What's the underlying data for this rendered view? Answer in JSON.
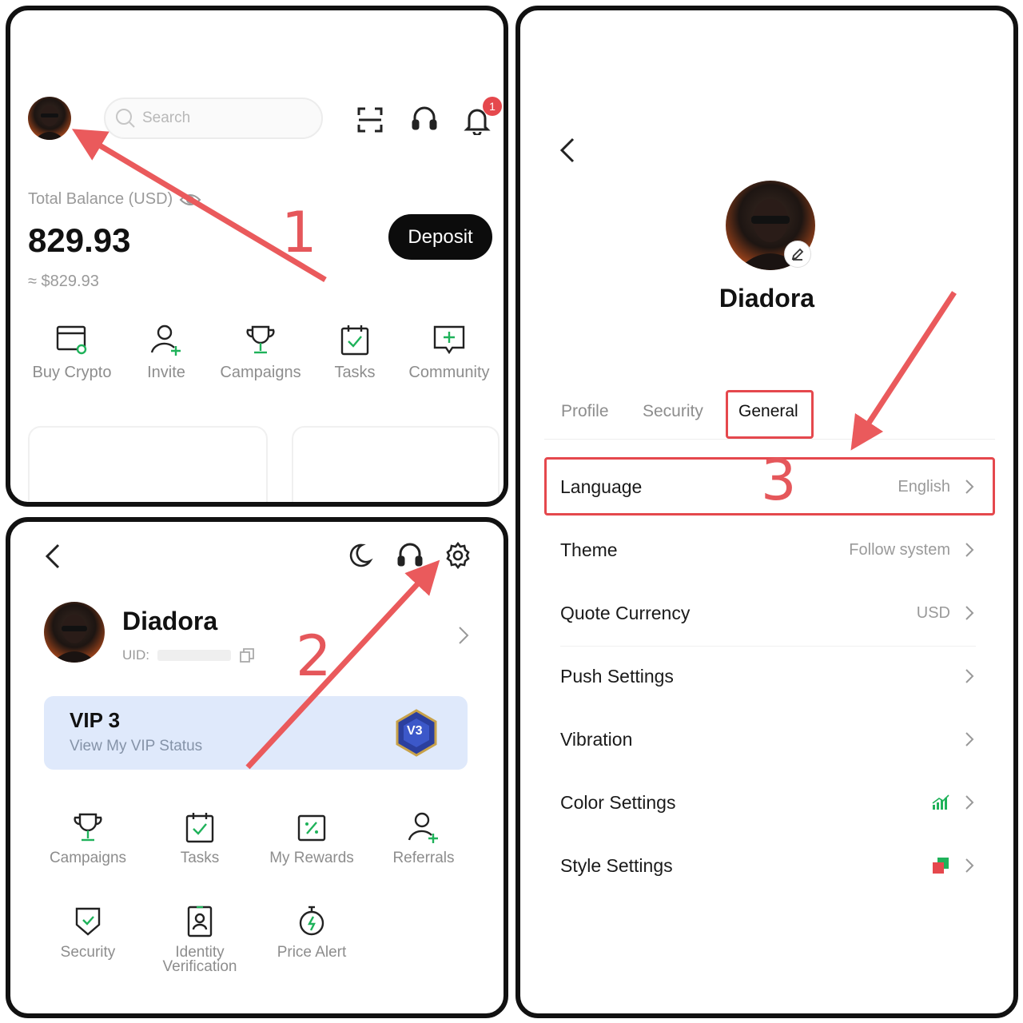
{
  "panel1": {
    "search_placeholder": "Search",
    "notification_count": "1",
    "balance_label": "Total Balance (USD)",
    "balance_value": "829.93",
    "balance_approx": "≈ $829.93",
    "deposit_label": "Deposit",
    "quick_actions": [
      {
        "label": "Buy Crypto",
        "icon": "card-icon"
      },
      {
        "label": "Invite",
        "icon": "person-add-icon"
      },
      {
        "label": "Campaigns",
        "icon": "trophy-icon"
      },
      {
        "label": "Tasks",
        "icon": "checklist-icon"
      },
      {
        "label": "Community",
        "icon": "chat-plus-icon"
      }
    ],
    "step_label": "1"
  },
  "panel2": {
    "username": "Diadora",
    "uid_label": "UID:",
    "vip_title": "VIP 3",
    "vip_subtitle": "View My VIP Status",
    "vip_badge_text": "V3",
    "grid_items": [
      {
        "label": "Campaigns",
        "icon": "trophy-icon"
      },
      {
        "label": "Tasks",
        "icon": "checklist-icon"
      },
      {
        "label": "My Rewards",
        "icon": "reward-icon"
      },
      {
        "label": "Referrals",
        "icon": "person-add-icon"
      },
      {
        "label": "Security",
        "icon": "shield-icon"
      },
      {
        "label": "Identity Verification",
        "icon": "id-card-icon"
      },
      {
        "label": "Price Alert",
        "icon": "stopwatch-icon"
      }
    ],
    "step_label": "2"
  },
  "panel3": {
    "username": "Diadora",
    "tabs": [
      "Profile",
      "Security",
      "General"
    ],
    "active_tab": "General",
    "settings": [
      {
        "label": "Language",
        "value": "English"
      },
      {
        "label": "Theme",
        "value": "Follow system"
      },
      {
        "label": "Quote Currency",
        "value": "USD"
      },
      {
        "label": "Push Settings",
        "value": ""
      },
      {
        "label": "Vibration",
        "value": ""
      },
      {
        "label": "Color Settings",
        "value": ""
      },
      {
        "label": "Style Settings",
        "value": ""
      }
    ],
    "step_label": "3"
  },
  "colors": {
    "accent_red": "#e5484d",
    "arrow_red": "#ea5a5c",
    "green": "#1fb25a",
    "vip_bg": "#dfe9fb"
  }
}
